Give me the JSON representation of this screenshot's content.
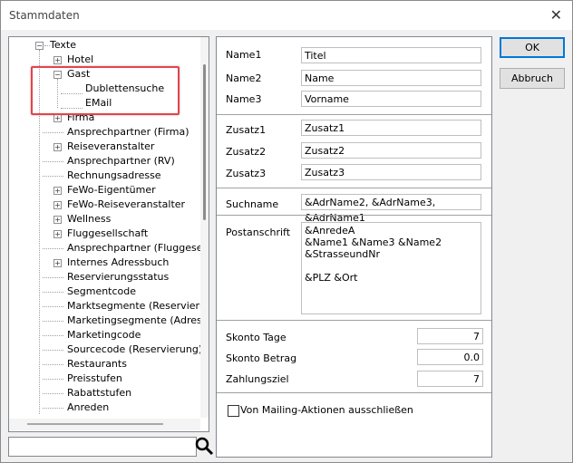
{
  "window": {
    "title": "Stammdaten"
  },
  "tree": {
    "items": [
      {
        "label": "Texte"
      },
      {
        "label": "Hotel"
      },
      {
        "label": "Gast"
      },
      {
        "label": "Dublettensuche"
      },
      {
        "label": "EMail"
      },
      {
        "label": "Firma"
      },
      {
        "label": "Ansprechpartner (Firma)"
      },
      {
        "label": "Reiseveranstalter"
      },
      {
        "label": "Ansprechpartner (RV)"
      },
      {
        "label": "Rechnungsadresse"
      },
      {
        "label": "FeWo-Eigentümer"
      },
      {
        "label": "FeWo-Reiseveranstalter"
      },
      {
        "label": "Wellness"
      },
      {
        "label": "Fluggesellschaft"
      },
      {
        "label": "Ansprechpartner (Fluggesellsc"
      },
      {
        "label": "Internes Adressbuch"
      },
      {
        "label": "Reservierungsstatus"
      },
      {
        "label": "Segmentcode"
      },
      {
        "label": "Marktsegmente (Reservierung"
      },
      {
        "label": "Marketingsegmente (Adresse)"
      },
      {
        "label": "Marketingcode"
      },
      {
        "label": "Sourcecode (Reservierung)"
      },
      {
        "label": "Restaurants"
      },
      {
        "label": "Preisstufen"
      },
      {
        "label": "Rabattstufen"
      },
      {
        "label": "Anreden"
      }
    ]
  },
  "search": {
    "value": ""
  },
  "form": {
    "name1_label": "Name1",
    "name1_value": "Titel",
    "name2_label": "Name2",
    "name2_value": "Name",
    "name3_label": "Name3",
    "name3_value": "Vorname",
    "zusatz1_label": "Zusatz1",
    "zusatz1_value": "Zusatz1",
    "zusatz2_label": "Zusatz2",
    "zusatz2_value": "Zusatz2",
    "zusatz3_label": "Zusatz3",
    "zusatz3_value": "Zusatz3",
    "suchname_label": "Suchname",
    "suchname_value": "&AdrName2, &AdrName3, &AdrName1",
    "postanschrift_label": "Postanschrift",
    "postanschrift_value": "&AnredeA\n&Name1 &Name3 &Name2\n&StrasseundNr\n\n&PLZ &Ort",
    "skonto_tage_label": "Skonto Tage",
    "skonto_tage_value": "7",
    "skonto_betrag_label": "Skonto Betrag",
    "skonto_betrag_value": "0.0",
    "zahlungsziel_label": "Zahlungsziel",
    "zahlungsziel_value": "7",
    "mailing_label": "Von Mailing-Aktionen ausschließen"
  },
  "buttons": {
    "ok": "OK",
    "cancel": "Abbruch"
  }
}
